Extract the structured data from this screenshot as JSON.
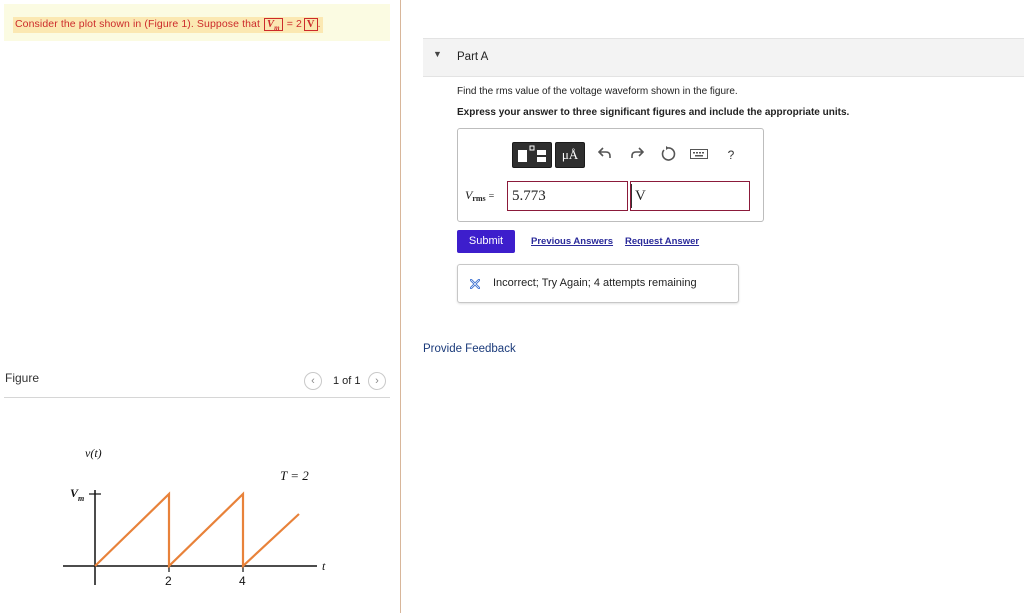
{
  "prompt": {
    "text": "Consider the plot shown in (Figure 1). Suppose that",
    "variable": "V",
    "variable_sub": "m",
    "equals_value": "= 2",
    "unit": "V",
    "period": "."
  },
  "figure": {
    "label": "Figure",
    "pager": "1 of 1",
    "prev_icon": "chevron-left-icon",
    "next_icon": "chevron-right-icon",
    "plot": {
      "y_label": "v(t)",
      "vm_label_main": "V",
      "vm_label_sub": "m",
      "period_label": "T = 2",
      "x_axis_label": "t",
      "x_ticks": [
        "2",
        "4"
      ]
    }
  },
  "part": {
    "caret_icon": "triangle-down-icon",
    "title": "Part A",
    "question": "Find the rms value of the voltage waveform shown in the figure.",
    "instruction": "Express your answer to three significant figures and include the appropriate units."
  },
  "toolbar": {
    "templates_icon": "templates-icon",
    "units_label": "μÅ",
    "undo_icon": "undo-icon",
    "redo_icon": "redo-icon",
    "reset_icon": "reset-icon",
    "keyboard_icon": "keyboard-icon",
    "help_label": "?"
  },
  "answer": {
    "variable": "V",
    "variable_sub": "rms",
    "equals": "=",
    "value": "5.773",
    "unit": "V"
  },
  "actions": {
    "submit_label": "Submit",
    "previous_answers_label": "Previous Answers",
    "request_answer_label": "Request Answer"
  },
  "feedback": {
    "icon": "x-icon",
    "message": "Incorrect; Try Again; 4 attempts remaining"
  },
  "provide_feedback_label": "Provide Feedback",
  "colors": {
    "prompt_text": "#cc2b2b",
    "prompt_highlight": "#fbe8b2",
    "prompt_banner_bg": "#fbfbe2",
    "submit_bg": "#3d1ecc",
    "plot_line": "#e8823a",
    "input_border": "#8b1a3a",
    "incorrect_icon": "#3a6fd0",
    "link": "#2a2a9a"
  }
}
